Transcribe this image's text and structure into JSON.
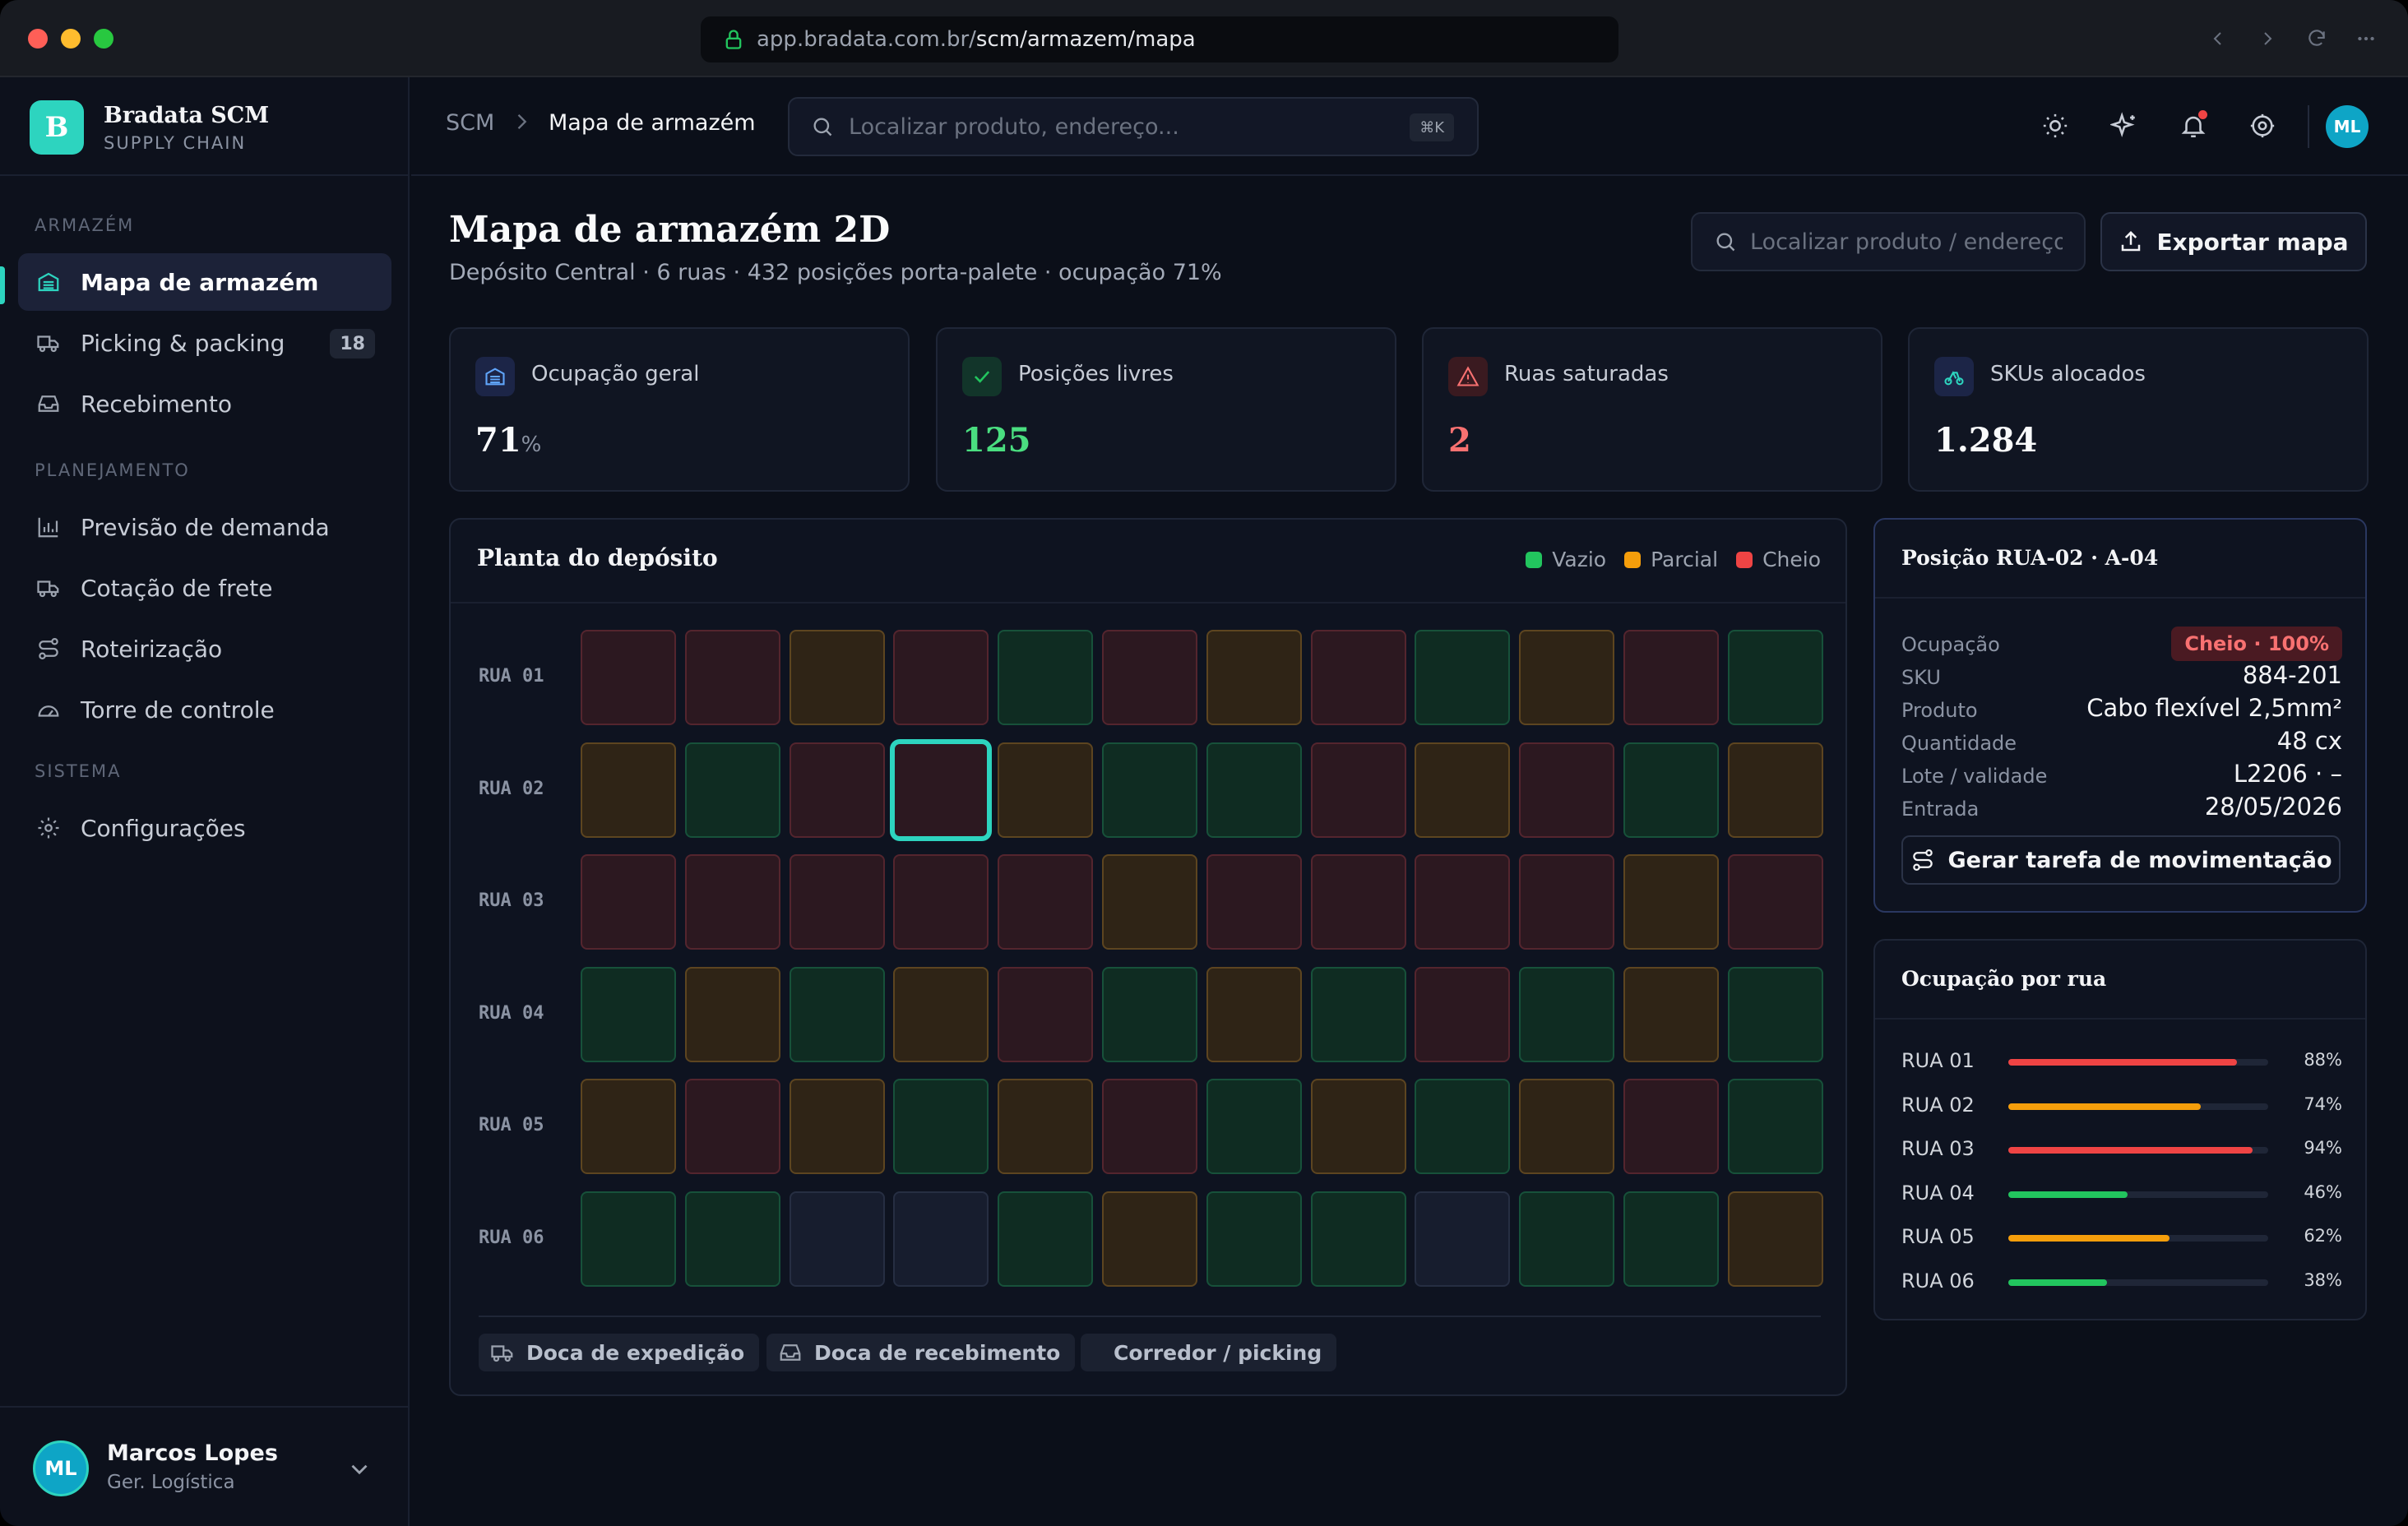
{
  "browser": {
    "url_host": "app.bradata.com.br/",
    "url_path": "scm/armazem/mapa"
  },
  "colors": {
    "accent": "#2dd4bf",
    "empty": "#22c55e",
    "partial": "#f59e0b",
    "full": "#ef4444"
  },
  "sidebar": {
    "brand_initial": "B",
    "brand_name": "Bradata SCM",
    "brand_sub": "SUPPLY CHAIN",
    "sections": [
      {
        "label": "ARMAZÉM"
      },
      {
        "label": "PLANEJAMENTO"
      },
      {
        "label": "SISTEMA"
      }
    ],
    "items": [
      {
        "label": "Mapa de armazém",
        "icon": "warehouse-icon",
        "active": true
      },
      {
        "label": "Picking & packing",
        "icon": "truck-icon",
        "badge": "18"
      },
      {
        "label": "Recebimento",
        "icon": "inbox-icon"
      },
      {
        "label": "Previsão de demanda",
        "icon": "bar-chart-icon"
      },
      {
        "label": "Cotação de frete",
        "icon": "truck-icon"
      },
      {
        "label": "Roteirização",
        "icon": "route-icon"
      },
      {
        "label": "Torre de controle",
        "icon": "gauge-icon"
      },
      {
        "label": "Configurações",
        "icon": "gear-icon"
      }
    ],
    "user": {
      "initials": "ML",
      "name": "Marcos Lopes",
      "role": "Ger. Logística"
    }
  },
  "topbar": {
    "breadcrumb_root": "SCM",
    "breadcrumb_current": "Mapa de armazém",
    "search_placeholder": "Localizar produto, endereço...",
    "search_shortcut": "⌘K",
    "avatar_initials": "ML"
  },
  "header": {
    "title": "Mapa de armazém 2D",
    "subtitle": "Depósito Central · 6 ruas · 432 posições porta-palete · ocupação 71%",
    "search_placeholder": "Localizar produto / endereço",
    "export_label": "Exportar mapa"
  },
  "kpis": [
    {
      "label": "Ocupação geral",
      "value": "71",
      "unit": "%",
      "icon": "warehouse-icon"
    },
    {
      "label": "Posições livres",
      "value": "125",
      "unit": "",
      "icon": "check-icon"
    },
    {
      "label": "Ruas saturadas",
      "value": "2",
      "unit": "",
      "icon": "alert-icon"
    },
    {
      "label": "SKUs alocados",
      "value": "1.284",
      "unit": "",
      "icon": "boxes-icon"
    }
  ],
  "map": {
    "title": "Planta do depósito",
    "legend": [
      {
        "label": "Vazio",
        "status": "empty"
      },
      {
        "label": "Parcial",
        "status": "partial"
      },
      {
        "label": "Cheio",
        "status": "full"
      }
    ],
    "rows": [
      {
        "label": "RUA 01",
        "cells": [
          "full",
          "full",
          "partial",
          "full",
          "empty",
          "full",
          "partial",
          "full",
          "empty",
          "partial",
          "full",
          "empty"
        ]
      },
      {
        "label": "RUA 02",
        "cells": [
          "partial",
          "empty",
          "full",
          "full",
          "partial",
          "empty",
          "empty",
          "full",
          "partial",
          "full",
          "empty",
          "partial"
        ]
      },
      {
        "label": "RUA 03",
        "cells": [
          "full",
          "full",
          "full",
          "full",
          "full",
          "partial",
          "full",
          "full",
          "full",
          "full",
          "partial",
          "full"
        ]
      },
      {
        "label": "RUA 04",
        "cells": [
          "empty",
          "partial",
          "empty",
          "partial",
          "full",
          "empty",
          "partial",
          "empty",
          "full",
          "empty",
          "partial",
          "empty"
        ]
      },
      {
        "label": "RUA 05",
        "cells": [
          "partial",
          "full",
          "partial",
          "empty",
          "partial",
          "full",
          "empty",
          "partial",
          "empty",
          "partial",
          "full",
          "empty"
        ]
      },
      {
        "label": "RUA 06",
        "cells": [
          "empty",
          "empty",
          "free",
          "free",
          "empty",
          "partial",
          "empty",
          "empty",
          "free",
          "empty",
          "empty",
          "partial"
        ]
      }
    ],
    "selected": {
      "row": 1,
      "col": 3
    },
    "footer_chips": [
      {
        "label": "Doca de expedição",
        "icon": "truck-icon"
      },
      {
        "label": "Doca de recebimento",
        "icon": "inbox-icon"
      },
      {
        "label": "Corredor / picking",
        "icon": ""
      }
    ]
  },
  "position": {
    "title": "Posição RUA-02 · A-04",
    "occupancy_label": "Ocupação",
    "occupancy_badge": "Cheio · 100%",
    "fields": [
      {
        "key": "SKU",
        "value": "884-201"
      },
      {
        "key": "Produto",
        "value": "Cabo flexível 2,5mm²"
      },
      {
        "key": "Quantidade",
        "value": "48 cx"
      },
      {
        "key": "Lote / validade",
        "value": "L2206 · –"
      },
      {
        "key": "Entrada",
        "value": "28/05/2026"
      }
    ],
    "action_label": "Gerar tarefa de movimentação"
  },
  "occupancy_by_street": {
    "title": "Ocupação por rua",
    "rows": [
      {
        "name": "RUA 01",
        "pct": 88,
        "label": "88%",
        "color": "#ef4444"
      },
      {
        "name": "RUA 02",
        "pct": 74,
        "label": "74%",
        "color": "#f59e0b"
      },
      {
        "name": "RUA 03",
        "pct": 94,
        "label": "94%",
        "color": "#ef4444"
      },
      {
        "name": "RUA 04",
        "pct": 46,
        "label": "46%",
        "color": "#22c55e"
      },
      {
        "name": "RUA 05",
        "pct": 62,
        "label": "62%",
        "color": "#f59e0b"
      },
      {
        "name": "RUA 06",
        "pct": 38,
        "label": "38%",
        "color": "#22c55e"
      }
    ]
  }
}
